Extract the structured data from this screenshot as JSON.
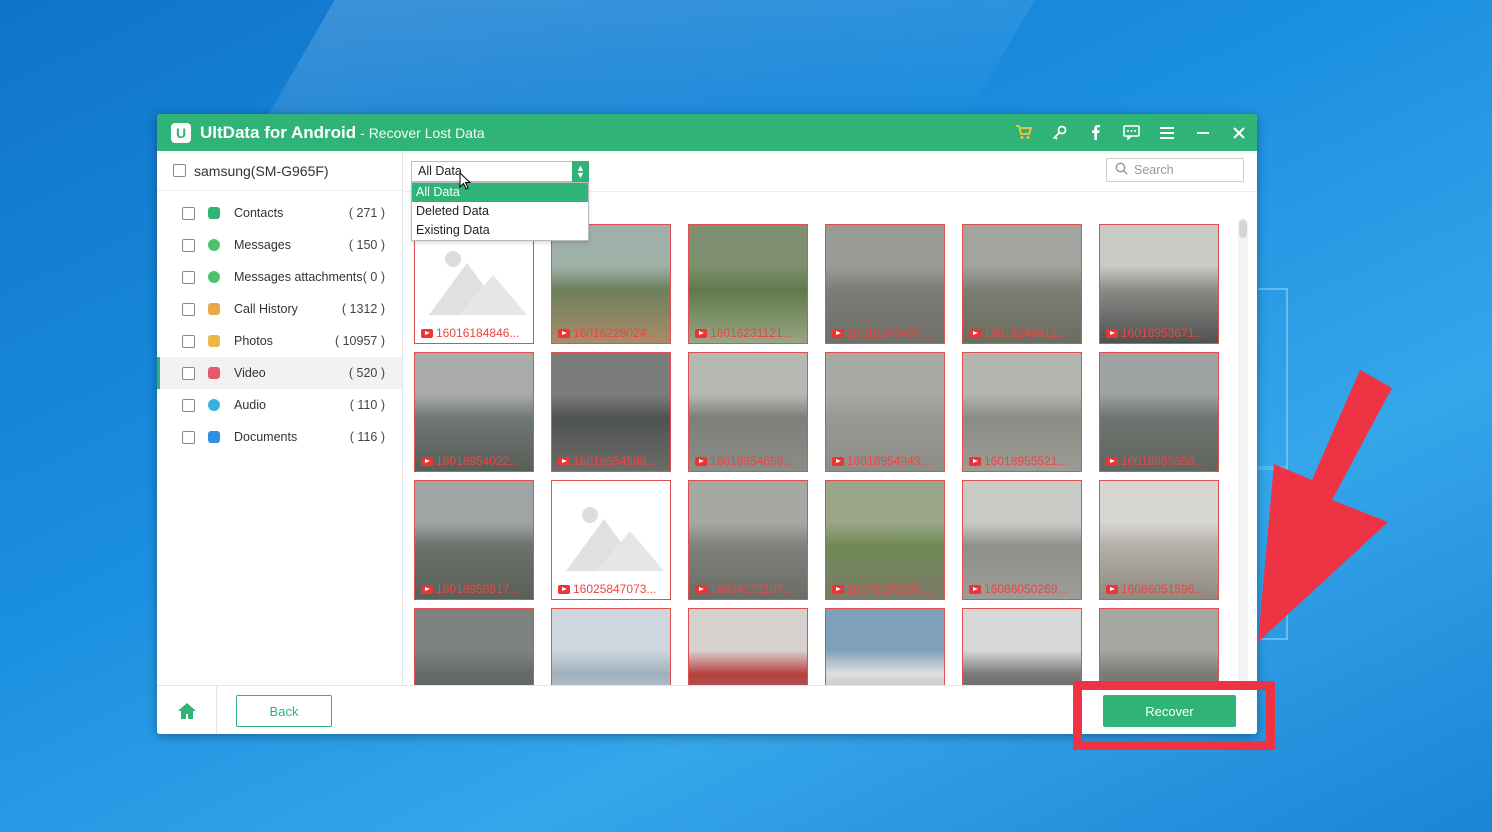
{
  "app": {
    "logo_letter": "U",
    "name": "UltData for Android",
    "subtitle": "- Recover Lost Data"
  },
  "titlebar_icons": [
    "cart-icon",
    "key-icon",
    "facebook-icon",
    "feedback-icon",
    "menu-icon",
    "minimize-icon",
    "close-icon"
  ],
  "device": {
    "label": "samsung(SM-G965F)"
  },
  "categories": [
    {
      "label": "Contacts",
      "count": "( 271 )",
      "icon_color": "#2fb377",
      "icon": "contacts-icon"
    },
    {
      "label": "Messages",
      "count": "( 150 )",
      "icon_color": "#4cc26e",
      "icon": "messages-icon"
    },
    {
      "label": "Messages attachments",
      "count": "( 0 )",
      "icon_color": "#4cc26e",
      "icon": "attachments-icon"
    },
    {
      "label": "Call History",
      "count": "( 1312 )",
      "icon_color": "#e8a94a",
      "icon": "call-history-icon"
    },
    {
      "label": "Photos",
      "count": "( 10957 )",
      "icon_color": "#e8b84a",
      "icon": "photos-icon"
    },
    {
      "label": "Video",
      "count": "( 520 )",
      "icon_color": "#e45a6a",
      "icon": "video-icon"
    },
    {
      "label": "Audio",
      "count": "( 110 )",
      "icon_color": "#3ab0e0",
      "icon": "audio-icon"
    },
    {
      "label": "Documents",
      "count": "( 116 )",
      "icon_color": "#2f8fe0",
      "icon": "documents-icon"
    }
  ],
  "filter": {
    "selected": "All Data",
    "options": [
      "All Data",
      "Deleted Data",
      "Existing Data"
    ]
  },
  "search": {
    "placeholder": "Search"
  },
  "thumbnails": [
    {
      "caption": "16016184846...",
      "colors": [
        "#ffffff"
      ],
      "placeholder": true
    },
    {
      "caption": "16016229024...",
      "colors": [
        "#9fb0a8",
        "#6d7f5c",
        "#a88d6a"
      ]
    },
    {
      "caption": "16016231121...",
      "colors": [
        "#7f9070",
        "#5f7a4a",
        "#9aa585"
      ]
    },
    {
      "caption": "16016247437...",
      "colors": [
        "#9a9a96",
        "#7c7c78",
        "#6f7068"
      ]
    },
    {
      "caption": "16016248412...",
      "colors": [
        "#a3a49f",
        "#7c7d72",
        "#6b6d60"
      ]
    },
    {
      "caption": "16018953671...",
      "colors": [
        "#c9cac6",
        "#8a8a86",
        "#505250"
      ]
    },
    {
      "caption": "16018954022...",
      "colors": [
        "#a9aca8",
        "#6f7772",
        "#585e58"
      ]
    },
    {
      "caption": "16018954598...",
      "colors": [
        "#7b7d7a",
        "#4f5350",
        "#6b6c68"
      ]
    },
    {
      "caption": "16018954659...",
      "colors": [
        "#b5b7b3",
        "#7d7f7a",
        "#8a8c86"
      ]
    },
    {
      "caption": "16018954943...",
      "colors": [
        "#a8a8a4",
        "#999994",
        "#8e8e88"
      ]
    },
    {
      "caption": "16018955521...",
      "colors": [
        "#b5b5b0",
        "#8c8c86",
        "#9c9c95"
      ]
    },
    {
      "caption": "16018955658...",
      "colors": [
        "#9ea2a0",
        "#6e746f",
        "#5f6660"
      ]
    },
    {
      "caption": "16018956517...",
      "colors": [
        "#a0a4a2",
        "#6b726c",
        "#5a6058"
      ]
    },
    {
      "caption": "16025847073...",
      "colors": [
        "#ffffff"
      ],
      "placeholder": true
    },
    {
      "caption": "16034172107...",
      "colors": [
        "#a6a8a4",
        "#7f827c",
        "#6a6d66"
      ]
    },
    {
      "caption": "16073299535...",
      "colors": [
        "#9aa58a",
        "#6f8a55",
        "#7d7a6a"
      ]
    },
    {
      "caption": "16086050269...",
      "colors": [
        "#c9c9c5",
        "#8f8f8b",
        "#9d9d98"
      ]
    },
    {
      "caption": "16086051596...",
      "colors": [
        "#d8d6d2",
        "#b3b0a8",
        "#8e8a80"
      ]
    },
    {
      "caption": "",
      "colors": [
        "#7f8380",
        "#666a66",
        "#5a5e5a"
      ]
    },
    {
      "caption": "",
      "colors": [
        "#cfd6de",
        "#9fb0bd",
        "#e6e8ea"
      ]
    },
    {
      "caption": "",
      "colors": [
        "#d7d2cf",
        "#b84040",
        "#8a8580"
      ]
    },
    {
      "caption": "",
      "colors": [
        "#7fa0b8",
        "#e0e0e0",
        "#6f8a70"
      ]
    },
    {
      "caption": "",
      "colors": [
        "#d8d8d8",
        "#7a7a78",
        "#4a4a48"
      ]
    },
    {
      "caption": "",
      "colors": [
        "#a5a8a2",
        "#787c74",
        "#6a6e68"
      ]
    }
  ],
  "footer": {
    "back_label": "Back",
    "recover_label": "Recover"
  },
  "annotation": {
    "highlight_color": "#ee3344"
  }
}
